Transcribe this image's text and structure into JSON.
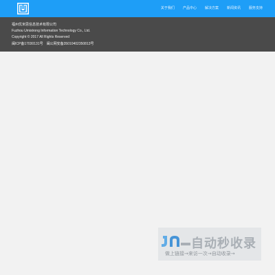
{
  "header": {
    "logo_icon": "company-logo",
    "nav": [
      "关于我们",
      "产品中心",
      "解决方案",
      "新闻资讯",
      "服务支持"
    ],
    "brand_color": "#1e9ef7"
  },
  "footer": {
    "company_cn": "福州优米思信息技术有限公司",
    "company_en": "Fuzhou Umistrong Information Technology Co., Ltd.",
    "copyright": "Copyright © 2017 All Rights Reserved",
    "icp": "闽ICP备17030131号　闽公网安备35010402350813号"
  },
  "watermark": {
    "title": "自动秒收录",
    "subtitle": "做上链接→来访一次→自动收录→"
  }
}
